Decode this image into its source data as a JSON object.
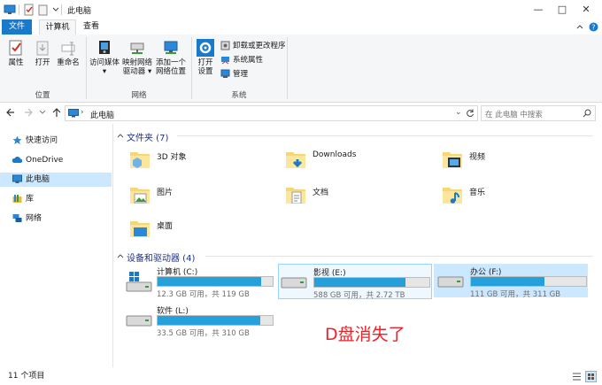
{
  "window": {
    "title": "此电脑"
  },
  "tabs": {
    "file": "文件",
    "computer": "计算机",
    "view": "查看"
  },
  "ribbon": {
    "location": {
      "label": "位置",
      "properties": "属性",
      "open": "打开",
      "rename": "重命名"
    },
    "network": {
      "label": "网络",
      "access_media": "访问媒体",
      "map_drive_1": "映射网络",
      "map_drive_2": "驱动器",
      "add_location_1": "添加一个",
      "add_location_2": "网络位置"
    },
    "system": {
      "label": "系统",
      "open_settings_1": "打开",
      "open_settings_2": "设置",
      "uninstall": "卸载或更改程序",
      "sys_props": "系统属性",
      "manage": "管理"
    }
  },
  "address": {
    "path": "此电脑",
    "search_placeholder": "在 此电脑 中搜索"
  },
  "nav": {
    "items": [
      "快速访问",
      "OneDrive",
      "此电脑",
      "库",
      "网络"
    ]
  },
  "folders": {
    "heading": "文件夹 (7)",
    "items": [
      "3D 对象",
      "Downloads",
      "视频",
      "图片",
      "文档",
      "音乐",
      "桌面"
    ]
  },
  "drives": {
    "heading": "设备和驱动器 (4)",
    "items": [
      {
        "name": "计算机 (C:)",
        "sub": "12.3 GB 可用，共 119 GB",
        "used": 0.9
      },
      {
        "name": "影视 (E:)",
        "sub": "588 GB 可用，共 2.72 TB",
        "used": 0.79
      },
      {
        "name": "办公 (F:)",
        "sub": "111 GB 可用，共 311 GB",
        "used": 0.64
      },
      {
        "name": "软件 (L:)",
        "sub": "33.5 GB 可用，共 310 GB",
        "used": 0.89
      }
    ]
  },
  "annotation": "D盘消失了",
  "status": {
    "count": "11 个项目"
  },
  "colors": {
    "accent": "#1979ca",
    "bar": "#26a0da",
    "selected": "#cce8ff",
    "annotation": "#e8242b"
  }
}
